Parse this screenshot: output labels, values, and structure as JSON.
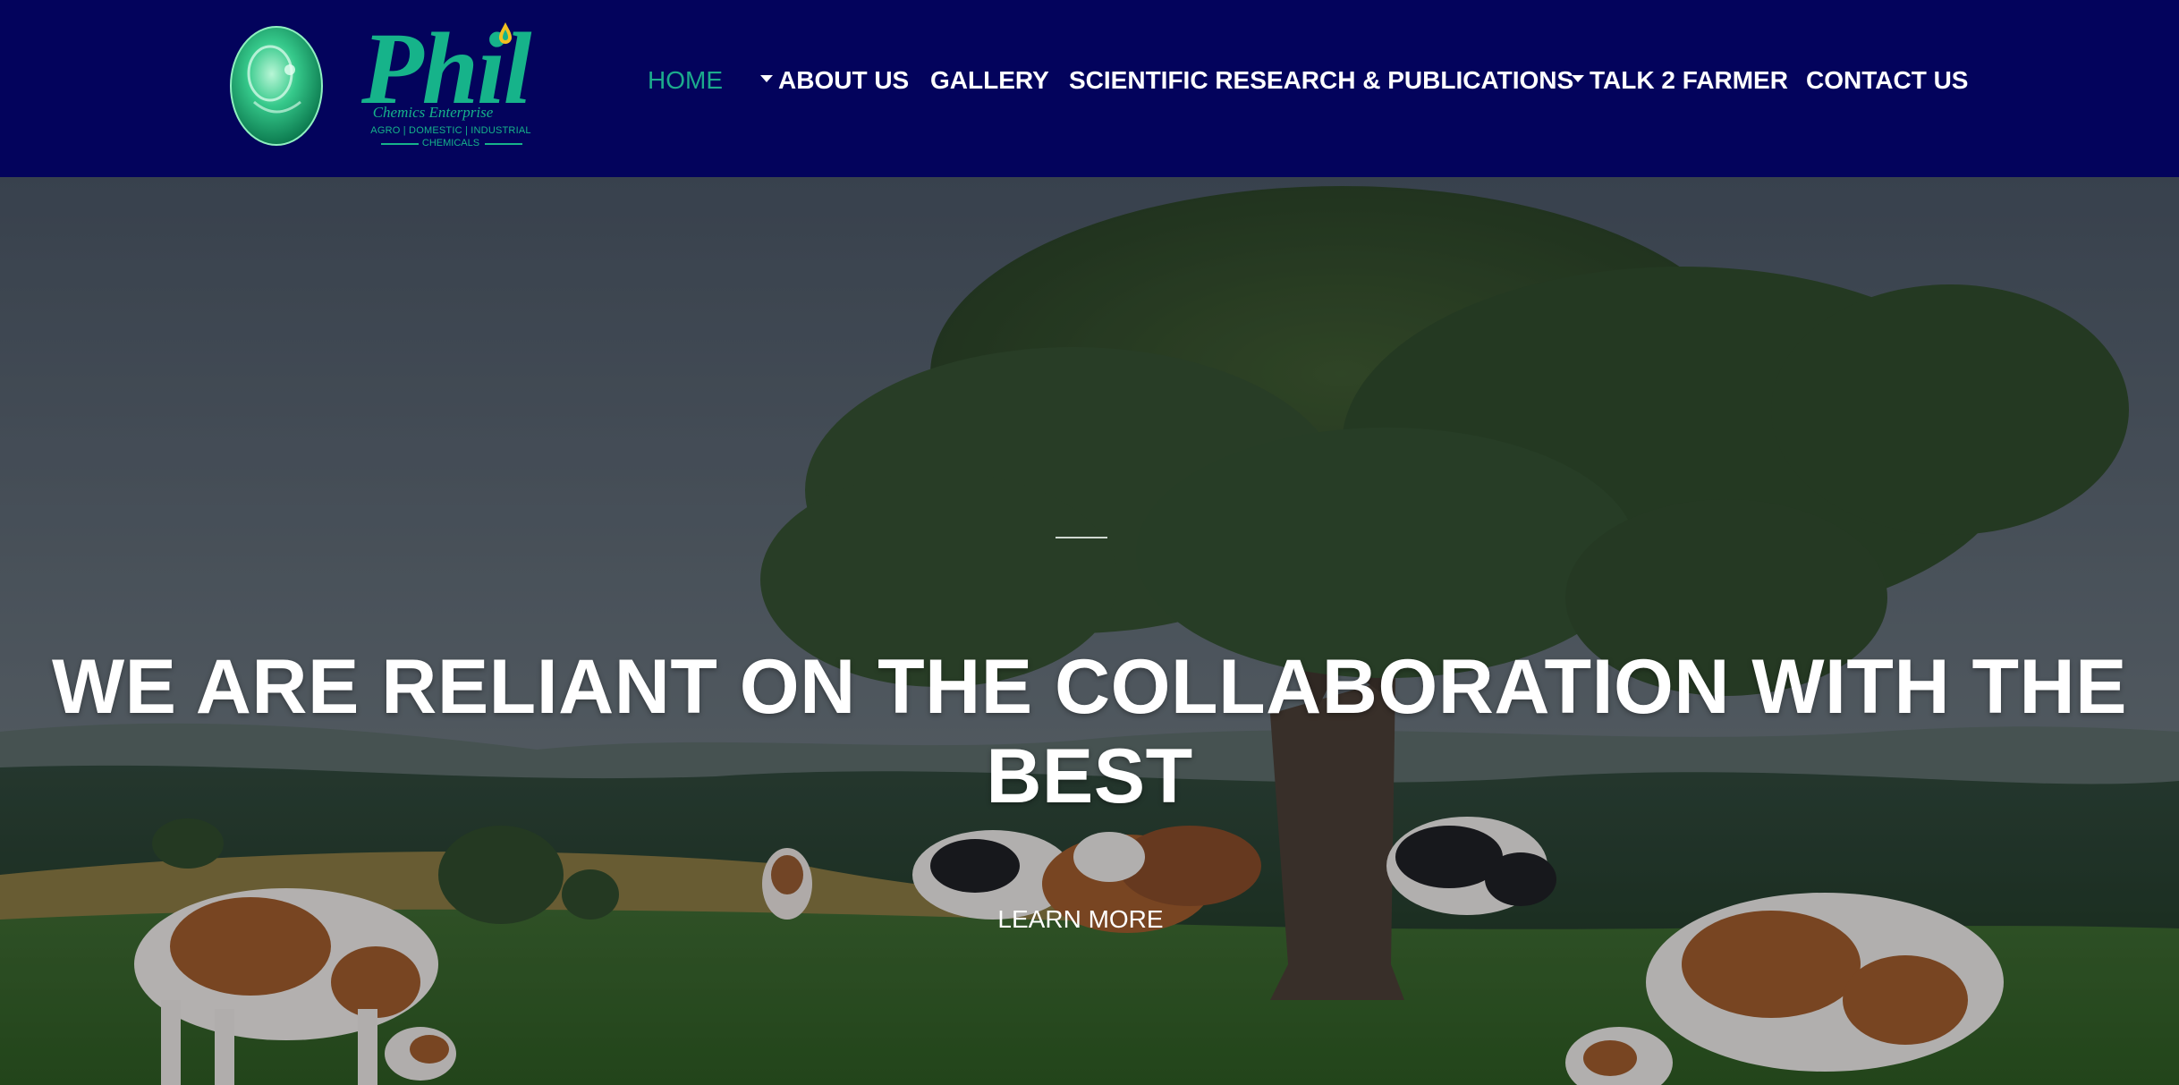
{
  "brand": {
    "name": "Phil",
    "subtitle": "Chemics Enterprise",
    "tagline": "AGRO | DOMESTIC | INDUSTRIAL",
    "tagline2": "CHEMICALS",
    "color": "#16b38a"
  },
  "nav": {
    "home": "HOME",
    "about": "ABOUT US",
    "gallery": "GALLERY",
    "research": "SCIENTIFIC RESEARCH & PUBLICATIONS",
    "talk": "TALK 2 FARMER",
    "contact": "CONTACT US",
    "active_color": "#1cab8c",
    "bg_color": "#03035c"
  },
  "hero": {
    "title": "WE ARE RELIANT ON THE COLLABORATION WITH THE BEST",
    "cta": "LEARN MORE"
  },
  "icons": {
    "logo_emblem": "green-oval-emblem-icon",
    "logo_drop": "water-drop-icon",
    "dropdown": "caret-down-icon"
  }
}
